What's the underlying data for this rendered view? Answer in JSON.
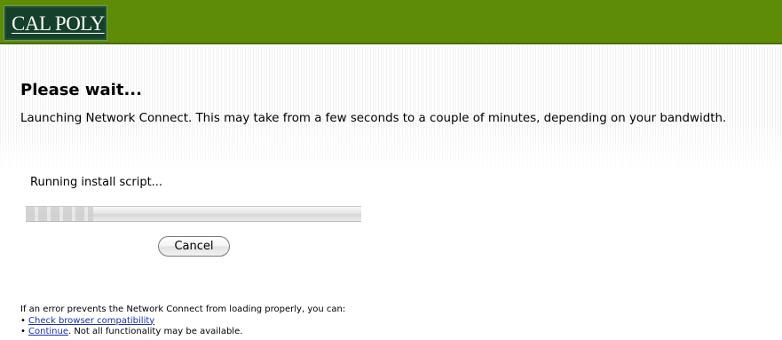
{
  "header": {
    "logo_text": "CAL POLY"
  },
  "main": {
    "title": "Please wait...",
    "message": "Launching Network Connect. This may take from a few seconds to a couple of minutes, depending on your bandwidth.",
    "status": "Running install script...",
    "progress": 0.2,
    "cancel_label": "Cancel"
  },
  "footer": {
    "intro": "If an error prevents the Network Connect from loading properly, you can:",
    "bullet": "•",
    "link_compat": "Check browser compatibility",
    "link_continue": "Continue",
    "continue_note": ". Not all functionality may be available."
  },
  "colors": {
    "header_green": "#5f8c06",
    "logo_bg": "#15402a",
    "link": "#1a2fa8"
  }
}
